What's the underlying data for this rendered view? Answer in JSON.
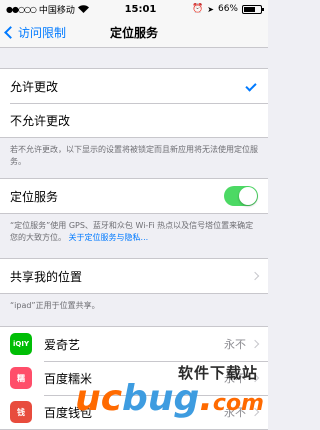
{
  "status_bar": {
    "carrier": "中国移动",
    "time": "15:01",
    "battery": "66%",
    "signal_dots": "●●○○○",
    "battery_fill": 0.66
  },
  "nav": {
    "back_label": "访问限制",
    "title": "定位服务"
  },
  "section1": {
    "items": [
      {
        "label": "允许更改",
        "checked": true
      },
      {
        "label": "不允许更改",
        "checked": false
      }
    ],
    "footer": "若不允许更改，以下显示的设置将被锁定而且新应用将无法使用定位服务。"
  },
  "section2": {
    "label": "定位服务",
    "toggle_on": true,
    "footer_text": "“定位服务”使用 GPS、蓝牙和众包 Wi-Fi 热点以及信号塔位置来确定您的大致方位。",
    "footer_link": "关于定位服务与隐私..."
  },
  "section3": {
    "label": "共享我的位置",
    "footer": "“ipad”正用于位置共享。"
  },
  "apps": [
    {
      "name": "爱奇艺",
      "value": "永不",
      "icon_text": "iQIY",
      "icon_color": "#00be06"
    },
    {
      "name": "百度糯米",
      "value": "永不",
      "icon_text": "糯",
      "icon_color": "#ff4e6a"
    },
    {
      "name": "百度钱包",
      "value": "永不",
      "icon_text": "钱",
      "icon_color": "#e84c3d"
    }
  ],
  "watermark": {
    "text": "软件下载站",
    "logo": "ucbug.com"
  }
}
